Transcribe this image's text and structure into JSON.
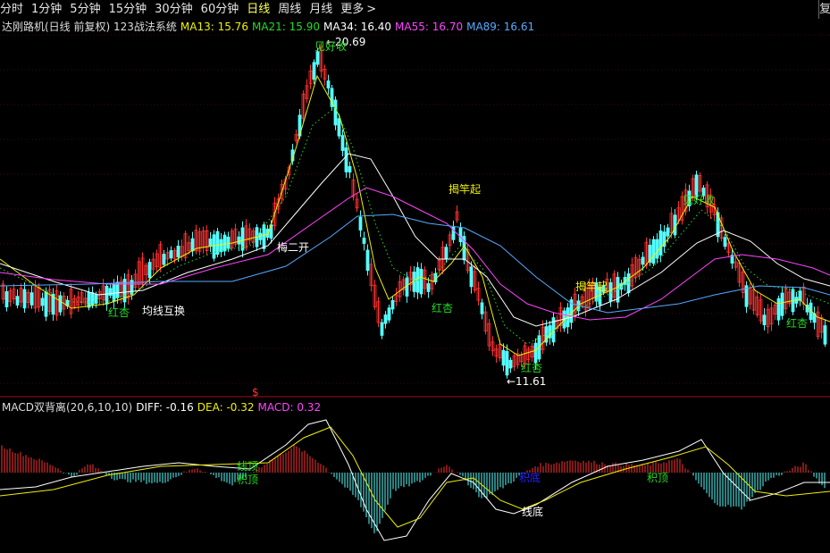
{
  "periods": [
    "分时",
    "1分钟",
    "5分钟",
    "15分钟",
    "30分钟",
    "60分钟",
    "日线",
    "周线",
    "月线",
    "更多"
  ],
  "active_period": "日线",
  "more_arrow": ">",
  "main": {
    "title": "达刚路机(日线 前复权) 123战法系统",
    "ma": [
      {
        "label": "MA13: 15.76",
        "color": "#f0f000"
      },
      {
        "label": "MA21: 15.90",
        "color": "#22dd22"
      },
      {
        "label": "MA34: 16.40",
        "color": "#ffffff"
      },
      {
        "label": "MA55: 16.70",
        "color": "#ff44ff"
      },
      {
        "label": "MA89: 16.61",
        "color": "#55aaff"
      }
    ],
    "high_label": "←20.69",
    "low_label": "←11.61",
    "annotations": [
      {
        "id": "peak-1",
        "text": "见好收",
        "color": "#22dd22"
      },
      {
        "id": "hongxing-1",
        "text": "红杏",
        "color": "#22dd22"
      },
      {
        "id": "ma-cross",
        "text": "均线互换",
        "color": "#ffffff"
      },
      {
        "id": "meierkai",
        "text": "梅二开",
        "color": "#ffffff"
      },
      {
        "id": "jiegan-1",
        "text": "揭竿起",
        "color": "#f0f000"
      },
      {
        "id": "hongxing-2",
        "text": "红杏",
        "color": "#22dd22"
      },
      {
        "id": "hongxing-3",
        "text": "红杏",
        "color": "#22dd22"
      },
      {
        "id": "jiegan-2",
        "text": "揭竿起",
        "color": "#f0f000"
      },
      {
        "id": "peak-2",
        "text": "见好收",
        "color": "#22dd22"
      },
      {
        "id": "hongxing-4",
        "text": "红杏",
        "color": "#22dd22"
      }
    ],
    "marker": "$"
  },
  "macd": {
    "title": "MACD双背离(20,6,10,10)",
    "diff": "DIFF: -0.16",
    "dea": "DEA: -0.32",
    "macd": "MACD: 0.32",
    "annotations": [
      {
        "id": "xianding",
        "text": "线顶",
        "color": "#22dd22"
      },
      {
        "id": "jiding",
        "text": "积顶",
        "color": "#22dd22"
      },
      {
        "id": "jidi",
        "text": "积底",
        "color": "#2222ff"
      },
      {
        "id": "jiding-2",
        "text": "积顶",
        "color": "#22dd22"
      },
      {
        "id": "xiandi",
        "text": "线底",
        "color": "#ffffff"
      }
    ]
  },
  "colors": {
    "up": "#ff3232",
    "down": "#54ffff",
    "divider": "#a01010",
    "grid": "#3a0a0a"
  }
}
